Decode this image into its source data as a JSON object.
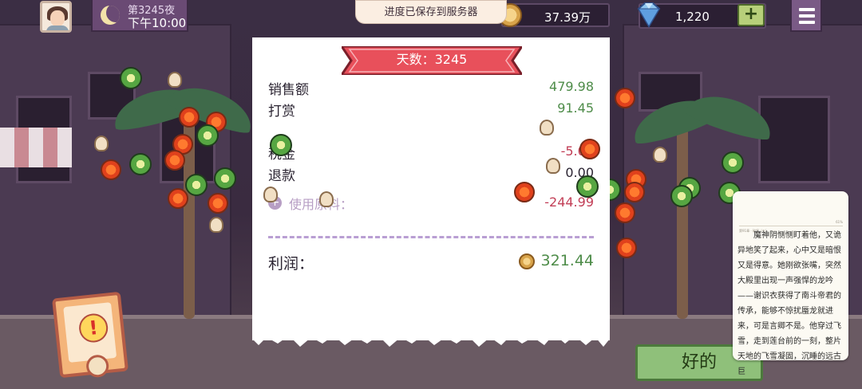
{
  "topbar": {
    "day_label": "第3245夜",
    "time_label": "下午10:00",
    "toast": "进度已保存到服务器",
    "coins": "37.39万",
    "gems": "1,220",
    "add_label": "+"
  },
  "receipt": {
    "ribbon": "天数：3245",
    "rows": [
      {
        "label": "销售额",
        "value": "479.98"
      },
      {
        "label": "打赏",
        "value": "91.45"
      },
      {
        "label": "税金",
        "value": "-5.00"
      },
      {
        "label": "退款",
        "value": "0.00"
      }
    ],
    "ingredients_label": "使用原料：",
    "ingredients_value": "-244.99",
    "profit_label": "利润：",
    "profit_value": "321.44"
  },
  "alert_icon_label": "!",
  "ok_button": "好的",
  "novel": {
    "header_left": "第91章 · 破境（五）",
    "header_right": "61%",
    "text": "魔神阴恻恻盯着他，又诡异地笑了起来，心中又是暗恨又是得意。她刚欲张嘴，突然大殿里出现一声强悍的龙吟——谢识衣获得了南斗帝君的传承，能够不惊扰蜃龙就进来，可是言卿不是。他穿过飞雪，走到莲台前的一刻，整片天地的飞雪凝固，沉睡的远古巨"
  },
  "colors": {
    "positive": "#4e8c49",
    "negative": "#c23f57",
    "ribbon": "#e8505b",
    "ok_button": "#8fc07a"
  }
}
